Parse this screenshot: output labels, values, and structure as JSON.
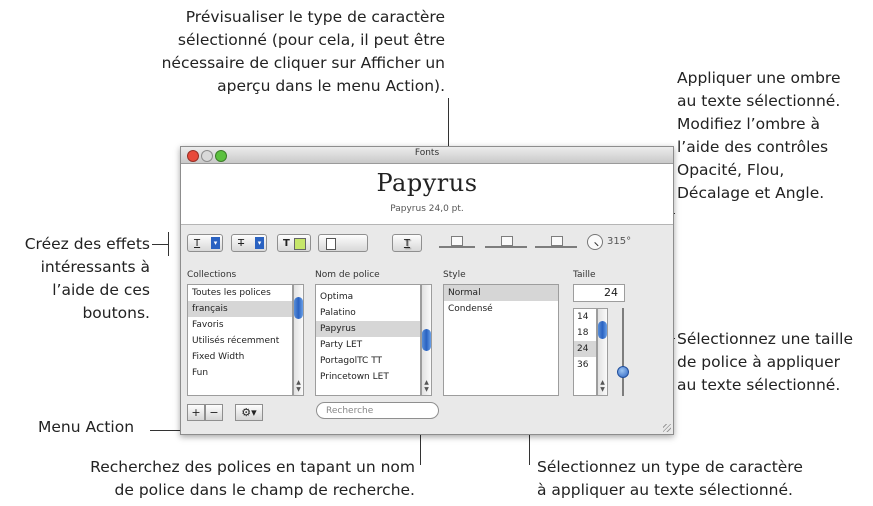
{
  "callouts": {
    "top_center": [
      "Prévisualiser le type de caractère",
      "sélectionné (pour cela, il peut être",
      "nécessaire de cliquer sur Afficher un",
      "aperçu dans le menu Action)."
    ],
    "top_right": [
      "Appliquer une ombre",
      "au texte sélectionné.",
      "Modifiez l’ombre à",
      "l’aide des contrôles",
      "Opacité, Flou,",
      "Décalage et Angle."
    ],
    "left": [
      "Créez des effets",
      "intéressants à",
      "l’aide de ces",
      "boutons."
    ],
    "right": [
      "Sélectionnez une taille",
      "de police à appliquer",
      "au texte sélectionné."
    ],
    "menu_action": "Menu Action",
    "bottom_left": [
      "Recherchez des polices en tapant  un nom",
      "de police dans le champ de recherche."
    ],
    "bottom_right": [
      "Sélectionnez un type de caractère",
      "à appliquer au texte sélectionné."
    ]
  },
  "window": {
    "title": "Fonts",
    "preview_font": "Papyrus",
    "preview_size": "Papyrus 24,0 pt.",
    "toolbar": {
      "underline_label": "T",
      "strike_label": "T",
      "text_color_label": "T",
      "doc_color_label": "",
      "shadow_label": "T",
      "angle_value": "315°"
    },
    "headers": {
      "collections": "Collections",
      "font_name": "Nom de police",
      "style": "Style",
      "size": "Taille"
    },
    "collections": [
      "Toutes les polices",
      "français",
      "Favoris",
      "Utilisés récemment",
      "Fixed Width",
      "Fun"
    ],
    "fonts": [
      "Optima",
      "Palatino",
      "Papyrus",
      "Party LET",
      "PortagolTC TT",
      "Princetown LET"
    ],
    "styles": [
      "Normal",
      "Condensé"
    ],
    "size_value": "24",
    "sizes": [
      "14",
      "18",
      "24",
      "36"
    ],
    "search_placeholder": "Recherche",
    "add_label": "+",
    "remove_label": "−",
    "action_label": "⚙▾"
  },
  "colors": {
    "close": "#e8493a",
    "minimize": "#f0b53d",
    "zoom": "#5cc13f",
    "selection_blue": "#2a62c1",
    "text_color_swatch": "#c6e66a"
  }
}
